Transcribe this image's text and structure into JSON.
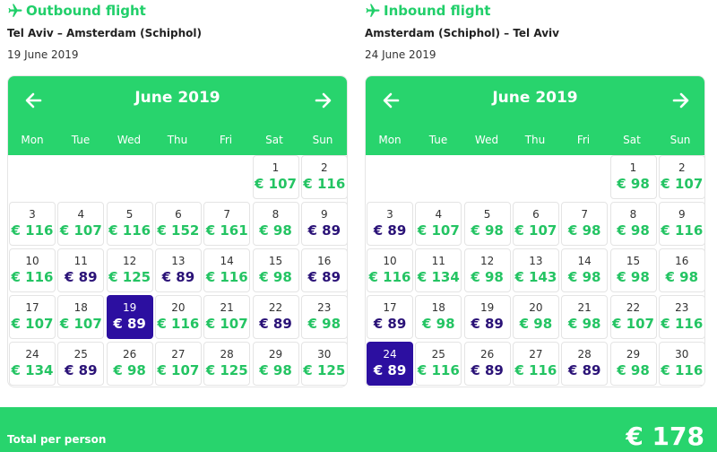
{
  "outbound": {
    "title": "Outbound flight",
    "route": "Tel Aviv – Amsterdam (Schiphol)",
    "date": "19 June 2019",
    "calendar": {
      "month": "June 2019",
      "weekdays": [
        "Mon",
        "Tue",
        "Wed",
        "Thu",
        "Fri",
        "Sat",
        "Sun"
      ],
      "first_weekday": 5,
      "selected_day": 19,
      "days": [
        {
          "day": "1",
          "price": "€ 107",
          "cheap": false
        },
        {
          "day": "2",
          "price": "€ 116",
          "cheap": false
        },
        {
          "day": "3",
          "price": "€ 116",
          "cheap": false
        },
        {
          "day": "4",
          "price": "€ 107",
          "cheap": false
        },
        {
          "day": "5",
          "price": "€ 116",
          "cheap": false
        },
        {
          "day": "6",
          "price": "€ 152",
          "cheap": false
        },
        {
          "day": "7",
          "price": "€ 161",
          "cheap": false
        },
        {
          "day": "8",
          "price": "€ 98",
          "cheap": false
        },
        {
          "day": "9",
          "price": "€ 89",
          "cheap": true
        },
        {
          "day": "10",
          "price": "€ 116",
          "cheap": false
        },
        {
          "day": "11",
          "price": "€ 89",
          "cheap": true
        },
        {
          "day": "12",
          "price": "€ 125",
          "cheap": false
        },
        {
          "day": "13",
          "price": "€ 89",
          "cheap": true
        },
        {
          "day": "14",
          "price": "€ 116",
          "cheap": false
        },
        {
          "day": "15",
          "price": "€ 98",
          "cheap": false
        },
        {
          "day": "16",
          "price": "€ 89",
          "cheap": true
        },
        {
          "day": "17",
          "price": "€ 107",
          "cheap": false
        },
        {
          "day": "18",
          "price": "€ 107",
          "cheap": false
        },
        {
          "day": "19",
          "price": "€ 89",
          "cheap": true
        },
        {
          "day": "20",
          "price": "€ 116",
          "cheap": false
        },
        {
          "day": "21",
          "price": "€ 107",
          "cheap": false
        },
        {
          "day": "22",
          "price": "€ 89",
          "cheap": true
        },
        {
          "day": "23",
          "price": "€ 98",
          "cheap": false
        },
        {
          "day": "24",
          "price": "€ 134",
          "cheap": false
        },
        {
          "day": "25",
          "price": "€ 89",
          "cheap": true
        },
        {
          "day": "26",
          "price": "€ 98",
          "cheap": false
        },
        {
          "day": "27",
          "price": "€ 107",
          "cheap": false
        },
        {
          "day": "28",
          "price": "€ 125",
          "cheap": false
        },
        {
          "day": "29",
          "price": "€ 98",
          "cheap": false
        },
        {
          "day": "30",
          "price": "€ 125",
          "cheap": false
        }
      ]
    }
  },
  "inbound": {
    "title": "Inbound flight",
    "route": "Amsterdam (Schiphol) – Tel Aviv",
    "date": "24 June 2019",
    "calendar": {
      "month": "June 2019",
      "weekdays": [
        "Mon",
        "Tue",
        "Wed",
        "Thu",
        "Fri",
        "Sat",
        "Sun"
      ],
      "first_weekday": 5,
      "selected_day": 24,
      "days": [
        {
          "day": "1",
          "price": "€ 98",
          "cheap": false
        },
        {
          "day": "2",
          "price": "€ 107",
          "cheap": false
        },
        {
          "day": "3",
          "price": "€ 89",
          "cheap": true
        },
        {
          "day": "4",
          "price": "€ 107",
          "cheap": false
        },
        {
          "day": "5",
          "price": "€ 98",
          "cheap": false
        },
        {
          "day": "6",
          "price": "€ 107",
          "cheap": false
        },
        {
          "day": "7",
          "price": "€ 98",
          "cheap": false
        },
        {
          "day": "8",
          "price": "€ 98",
          "cheap": false
        },
        {
          "day": "9",
          "price": "€ 116",
          "cheap": false
        },
        {
          "day": "10",
          "price": "€ 116",
          "cheap": false
        },
        {
          "day": "11",
          "price": "€ 134",
          "cheap": false
        },
        {
          "day": "12",
          "price": "€ 98",
          "cheap": false
        },
        {
          "day": "13",
          "price": "€ 143",
          "cheap": false
        },
        {
          "day": "14",
          "price": "€ 98",
          "cheap": false
        },
        {
          "day": "15",
          "price": "€ 98",
          "cheap": false
        },
        {
          "day": "16",
          "price": "€ 98",
          "cheap": false
        },
        {
          "day": "17",
          "price": "€ 89",
          "cheap": true
        },
        {
          "day": "18",
          "price": "€ 98",
          "cheap": false
        },
        {
          "day": "19",
          "price": "€ 89",
          "cheap": true
        },
        {
          "day": "20",
          "price": "€ 98",
          "cheap": false
        },
        {
          "day": "21",
          "price": "€ 98",
          "cheap": false
        },
        {
          "day": "22",
          "price": "€ 107",
          "cheap": false
        },
        {
          "day": "23",
          "price": "€ 116",
          "cheap": false
        },
        {
          "day": "24",
          "price": "€ 89",
          "cheap": true
        },
        {
          "day": "25",
          "price": "€ 116",
          "cheap": false
        },
        {
          "day": "26",
          "price": "€ 89",
          "cheap": true
        },
        {
          "day": "27",
          "price": "€ 116",
          "cheap": false
        },
        {
          "day": "28",
          "price": "€ 89",
          "cheap": true
        },
        {
          "day": "29",
          "price": "€ 98",
          "cheap": false
        },
        {
          "day": "30",
          "price": "€ 116",
          "cheap": false
        }
      ]
    }
  },
  "footer": {
    "total_label": "Total per person",
    "total_amount": "€ 178"
  },
  "colors": {
    "brand_green": "#28d46d",
    "price_green": "#24c463",
    "cheap_purple": "#2a1277",
    "selected": "#2c0fa0"
  },
  "icons": {
    "plane": "airplane-icon",
    "prev": "arrow-left-icon",
    "next": "arrow-right-icon"
  }
}
